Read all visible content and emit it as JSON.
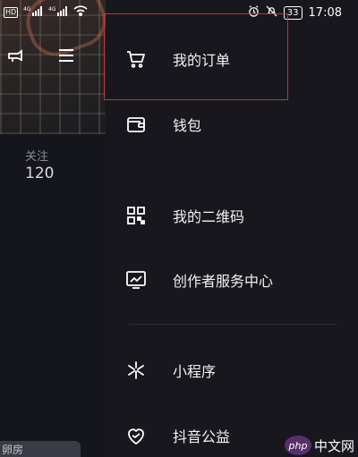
{
  "status_bar": {
    "hd_badge": "HD",
    "signal1_label": "4G",
    "signal2_label": "4G",
    "battery": "33",
    "time": "17:08"
  },
  "profile": {
    "follow_label": "关注",
    "follow_count": "120",
    "bottom_text": "卵房"
  },
  "menu": {
    "items": [
      {
        "label": "我的订单",
        "icon": "cart-icon"
      },
      {
        "label": "钱包",
        "icon": "wallet-icon"
      },
      {
        "label": "我的二维码",
        "icon": "qr-code-icon"
      },
      {
        "label": "创作者服务中心",
        "icon": "creator-chart-icon"
      },
      {
        "label": "小程序",
        "icon": "mini-program-icon"
      },
      {
        "label": "抖音公益",
        "icon": "charity-heart-icon"
      }
    ]
  },
  "watermark": {
    "php": "php",
    "site": "中文网"
  },
  "colors": {
    "highlight": "#c6323a",
    "drawer_bg": "#17171d"
  }
}
